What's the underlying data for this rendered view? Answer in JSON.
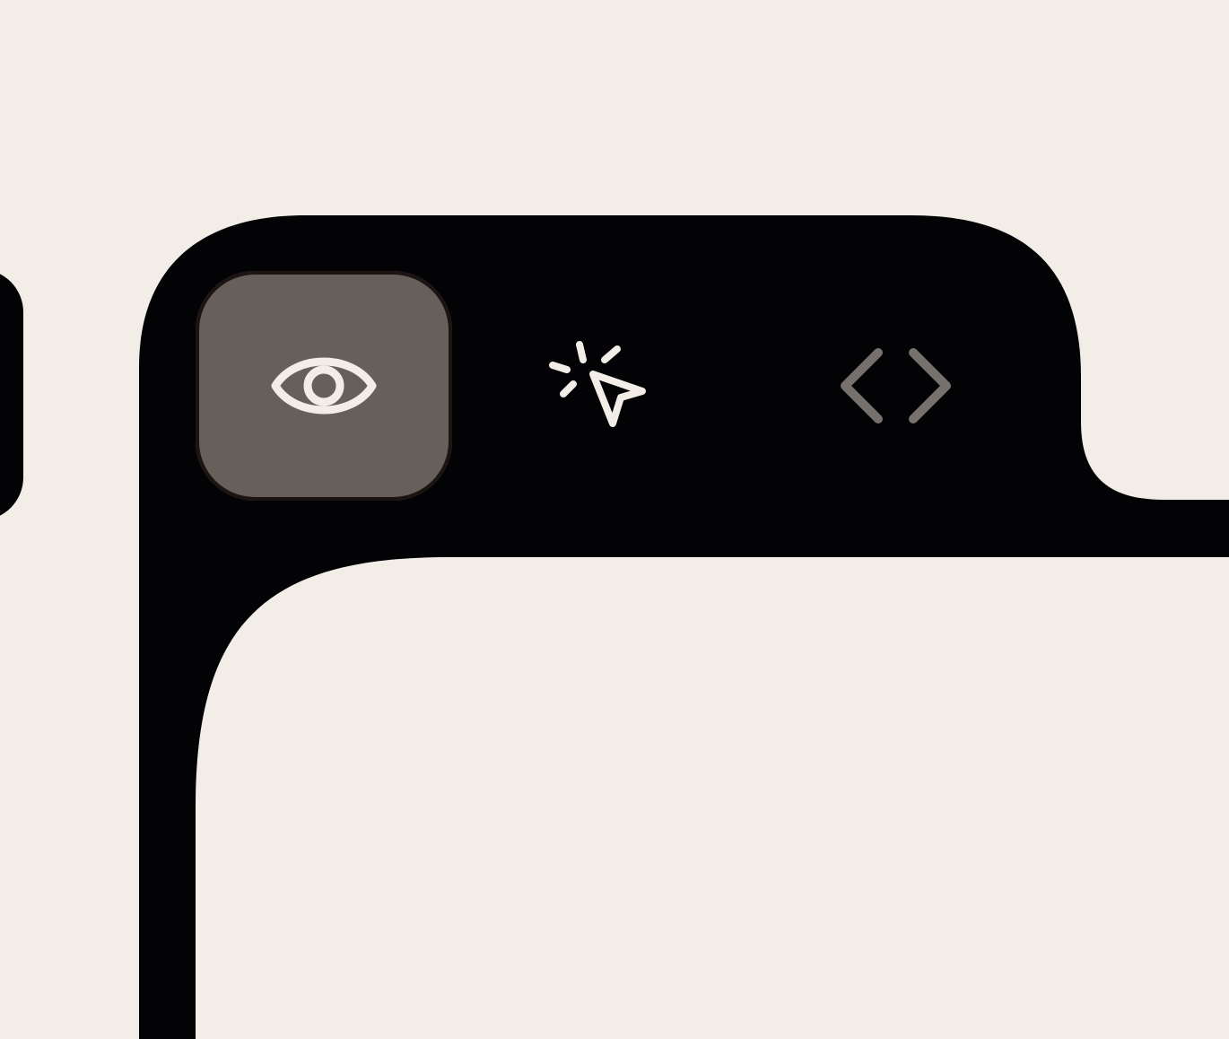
{
  "colors": {
    "background": "#f2ede7",
    "frame": "#030205",
    "active_button": "#675f59",
    "icon_light": "#f2ede7",
    "icon_muted": "#77716d"
  },
  "toolbar": {
    "active_mode": "preview",
    "buttons": [
      {
        "name": "preview",
        "icon": "eye-icon",
        "active": true
      },
      {
        "name": "interact",
        "icon": "sparkle-cursor-icon",
        "active": false
      },
      {
        "name": "code",
        "icon": "code-icon",
        "active": false
      }
    ]
  }
}
